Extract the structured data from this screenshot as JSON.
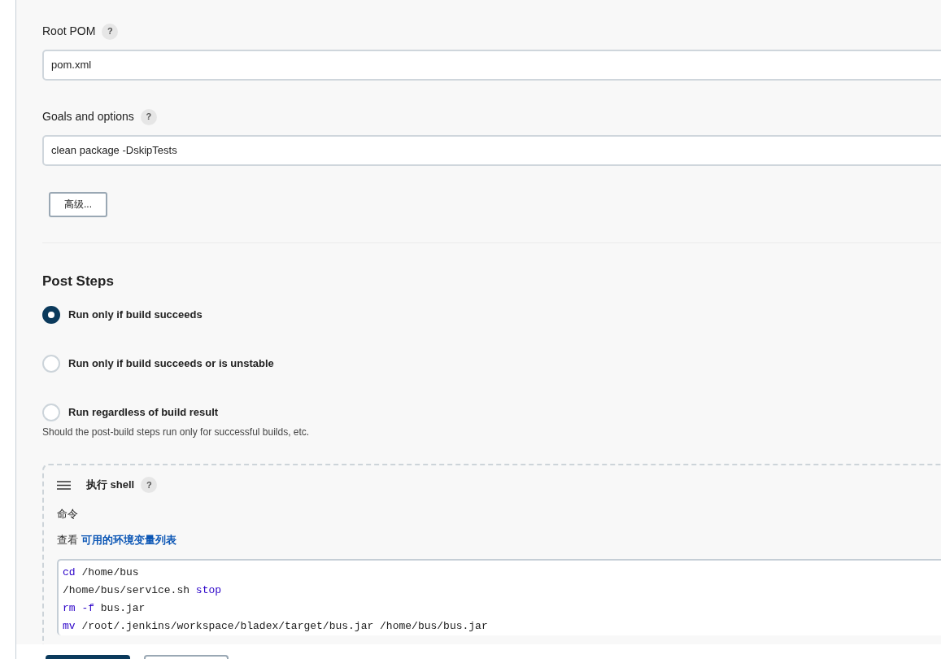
{
  "fields": [
    {
      "label": "Root POM",
      "value": "pom.xml"
    },
    {
      "label": "Goals and options",
      "value": "clean package -DskipTests"
    }
  ],
  "help_mark": "?",
  "advanced_button": "高级...",
  "post_steps": {
    "title": "Post Steps",
    "options": [
      {
        "label": "Run only if build succeeds",
        "selected": true
      },
      {
        "label": "Run only if build succeeds or is unstable",
        "selected": false
      },
      {
        "label": "Run regardless of build result",
        "selected": false
      }
    ],
    "description": "Should the post-build steps run only for successful builds, etc."
  },
  "shell_step": {
    "title": "执行 shell",
    "command_label": "命令",
    "env_prefix": "查看",
    "env_link": "可用的环境变量列表",
    "code_lines": [
      [
        {
          "text": "cd",
          "kind": "keyword"
        },
        {
          "text": " /home/bus",
          "kind": "plain"
        }
      ],
      [
        {
          "text": "/home/bus/service.sh ",
          "kind": "plain"
        },
        {
          "text": "stop",
          "kind": "keyword"
        }
      ],
      [
        {
          "text": "rm",
          "kind": "keyword"
        },
        {
          "text": " -f",
          "kind": "keyword"
        },
        {
          "text": " bus.jar",
          "kind": "plain"
        }
      ],
      [
        {
          "text": "mv",
          "kind": "keyword"
        },
        {
          "text": " /root/.jenkins/workspace/bladex/target/bus.jar /home/bus/bus.jar",
          "kind": "plain"
        }
      ]
    ]
  },
  "bottom_buttons": [
    {
      "kind": "primary"
    },
    {
      "kind": "secondary"
    }
  ]
}
